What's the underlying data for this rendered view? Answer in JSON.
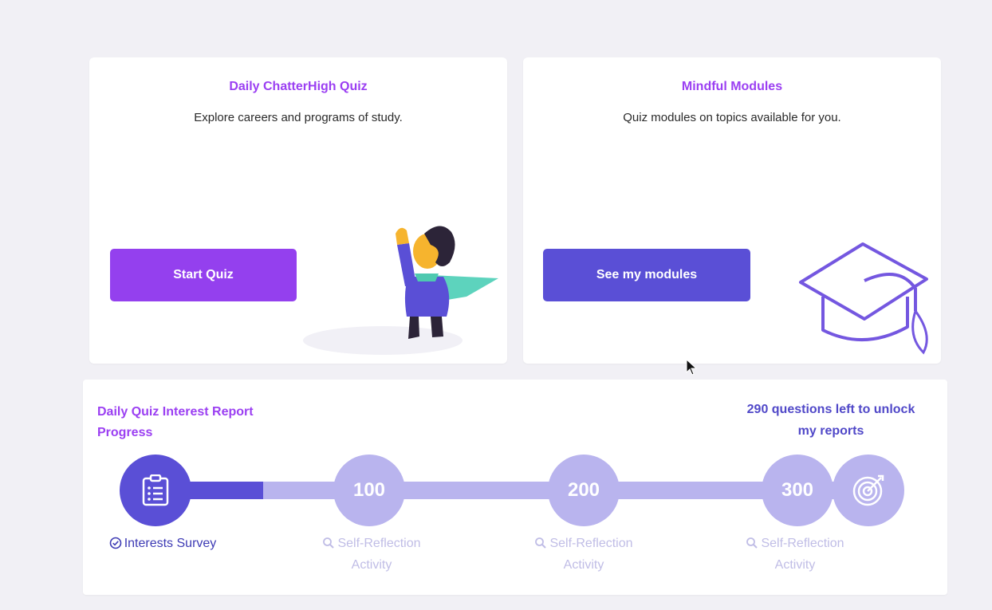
{
  "quiz_card": {
    "title": "Daily ChatterHigh Quiz",
    "description": "Explore careers and programs of study.",
    "button_label": "Start Quiz"
  },
  "modules_card": {
    "title": "Mindful Modules",
    "description": "Quiz modules on topics available for you.",
    "button_label": "See my modules"
  },
  "progress": {
    "title": "Daily Quiz Interest Report Progress",
    "questions_left": "290 questions left to unlock my reports",
    "completed_fraction": 0.1,
    "milestones": [
      {
        "value": "",
        "label": "Interests Survey",
        "icon": "clipboard-icon",
        "status_icon": "check-circle-icon",
        "done": true
      },
      {
        "value": "100",
        "label": "Self-Reflection Activity",
        "status_icon": "search-icon",
        "done": false
      },
      {
        "value": "200",
        "label": "Self-Reflection Activity",
        "status_icon": "search-icon",
        "done": false
      },
      {
        "value": "300",
        "label": "Self-Reflection Activity",
        "status_icon": "search-icon",
        "done": false
      },
      {
        "value": "",
        "label": "",
        "icon": "target-icon",
        "done": false
      }
    ]
  },
  "colors": {
    "purple_accent": "#9440ee",
    "indigo_accent": "#5a4fd6",
    "track_light": "#b9b4ee",
    "background": "#f1f0f5"
  }
}
